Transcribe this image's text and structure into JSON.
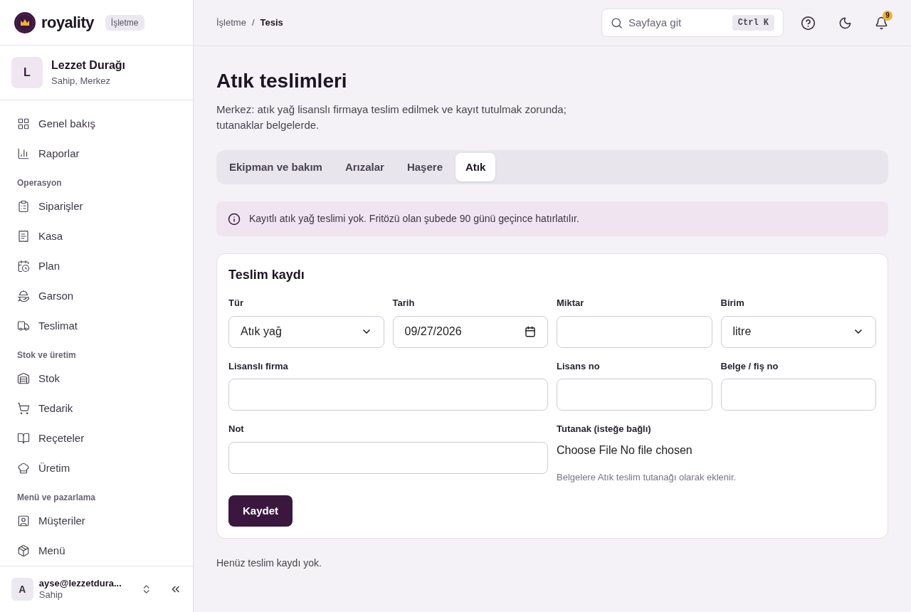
{
  "brand": {
    "name": "royality",
    "badge": "İşletme"
  },
  "business": {
    "initial": "L",
    "name": "Lezzet Durağı",
    "role": "Sahip, Merkez"
  },
  "nav": [
    {
      "kind": "item",
      "label": "Genel bakış"
    },
    {
      "kind": "item",
      "label": "Raporlar"
    },
    {
      "kind": "section",
      "label": "Operasyon"
    },
    {
      "kind": "item",
      "label": "Siparişler"
    },
    {
      "kind": "item",
      "label": "Kasa"
    },
    {
      "kind": "item",
      "label": "Plan"
    },
    {
      "kind": "item",
      "label": "Garson"
    },
    {
      "kind": "item",
      "label": "Teslimat"
    },
    {
      "kind": "section",
      "label": "Stok ve üretim"
    },
    {
      "kind": "item",
      "label": "Stok"
    },
    {
      "kind": "item",
      "label": "Tedarik"
    },
    {
      "kind": "item",
      "label": "Reçeteler"
    },
    {
      "kind": "item",
      "label": "Üretim"
    },
    {
      "kind": "section",
      "label": "Menü ve pazarlama"
    },
    {
      "kind": "item",
      "label": "Müşteriler"
    },
    {
      "kind": "item",
      "label": "Menü"
    }
  ],
  "user": {
    "initial": "A",
    "email": "ayse@lezzetdura...",
    "role": "Sahip"
  },
  "breadcrumb": [
    "İşletme",
    "/",
    "Tesis"
  ],
  "search": {
    "placeholder": "Sayfaya git",
    "shortcut": "Ctrl K"
  },
  "notifications": {
    "count": "9"
  },
  "page": {
    "title": "Atık teslimleri",
    "description": "Merkez: atık yağ lisanslı firmaya teslim edilmek ve kayıt tutulmak zorunda; tutanaklar belgelerde."
  },
  "tabs": [
    {
      "label": "Ekipman ve bakım",
      "selected": false
    },
    {
      "label": "Arızalar",
      "selected": false
    },
    {
      "label": "Haşere",
      "selected": false
    },
    {
      "label": "Atık",
      "selected": true
    }
  ],
  "notice": "Kayıtlı atık yağ teslimi yok. Fritözü olan şubede 90 günü geçince hatırlatılır.",
  "form": {
    "title": "Teslim kaydı",
    "fields": [
      {
        "kind": "select",
        "label": "Tür",
        "value": "Atık yağ"
      },
      {
        "kind": "date",
        "label": "Tarih",
        "value": "09/27/2026"
      },
      {
        "kind": "text",
        "label": "Miktar"
      },
      {
        "kind": "select",
        "label": "Birim",
        "value": "litre"
      },
      {
        "kind": "text",
        "label": "Lisanslı firma"
      },
      {
        "kind": "text",
        "label": "Lisans no"
      },
      {
        "kind": "text",
        "label": "Belge / fiş no"
      },
      {
        "kind": "text",
        "label": "Not"
      },
      {
        "kind": "file",
        "label": "Tutanak (isteğe bağlı)",
        "button": "Choose File",
        "status": "No file chosen",
        "hint": "Belgelere Atık teslim tutanağı olarak eklenir."
      }
    ],
    "submit": "Kaydet"
  },
  "empty": "Henüz teslim kaydı yok."
}
